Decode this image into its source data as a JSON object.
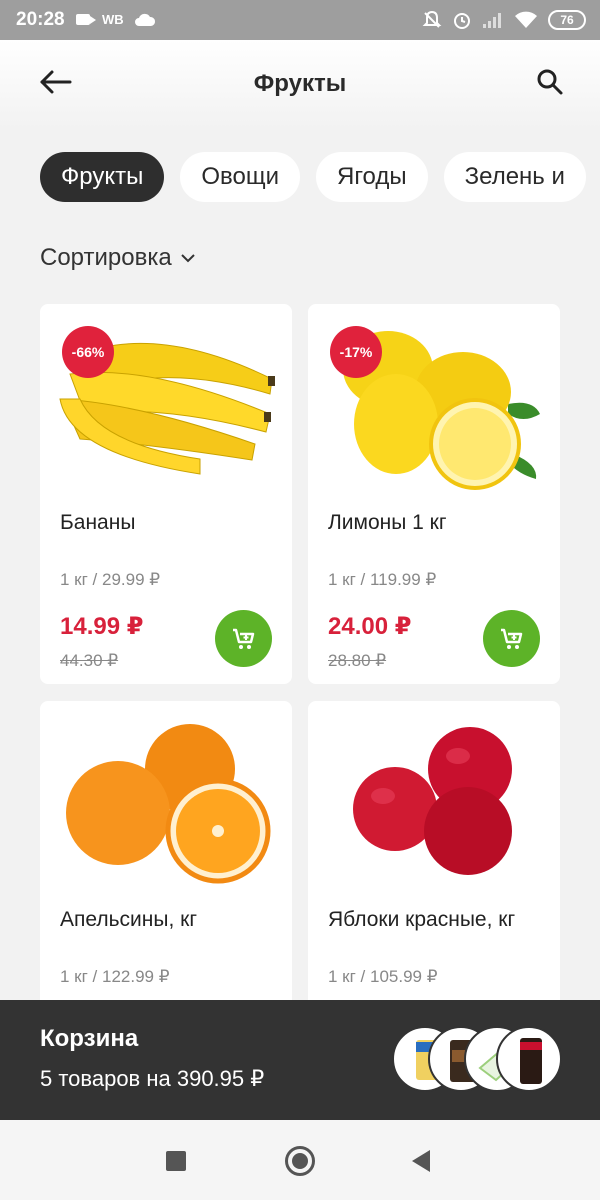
{
  "status_bar": {
    "time": "20:28",
    "carrier": "WB",
    "battery": "76"
  },
  "header": {
    "title": "Фрукты"
  },
  "tabs": [
    {
      "label": "Фрукты",
      "active": true
    },
    {
      "label": "Овощи",
      "active": false
    },
    {
      "label": "Ягоды",
      "active": false
    },
    {
      "label": "Зелень и"
    }
  ],
  "sort": {
    "label": "Сортировка"
  },
  "products": [
    {
      "name": "Бананы",
      "unit_price": "1 кг / 29.99 ₽",
      "price": "14.99 ₽",
      "old_price": "44.30 ₽",
      "discount": "-66%"
    },
    {
      "name": "Лимоны 1 кг",
      "unit_price": "1 кг / 119.99 ₽",
      "price": "24.00 ₽",
      "old_price": "28.80 ₽",
      "discount": "-17%"
    },
    {
      "name": "Апельсины, кг",
      "unit_price": "1 кг / 122.99 ₽"
    },
    {
      "name": "Яблоки красные, кг",
      "unit_price": "1 кг / 105.99 ₽"
    }
  ],
  "cart": {
    "title": "Корзина",
    "summary": "5 товаров на 390.95 ₽"
  },
  "colors": {
    "accent_red": "#d8213b",
    "cart_green": "#5db328",
    "dark": "#2e2e2e"
  }
}
